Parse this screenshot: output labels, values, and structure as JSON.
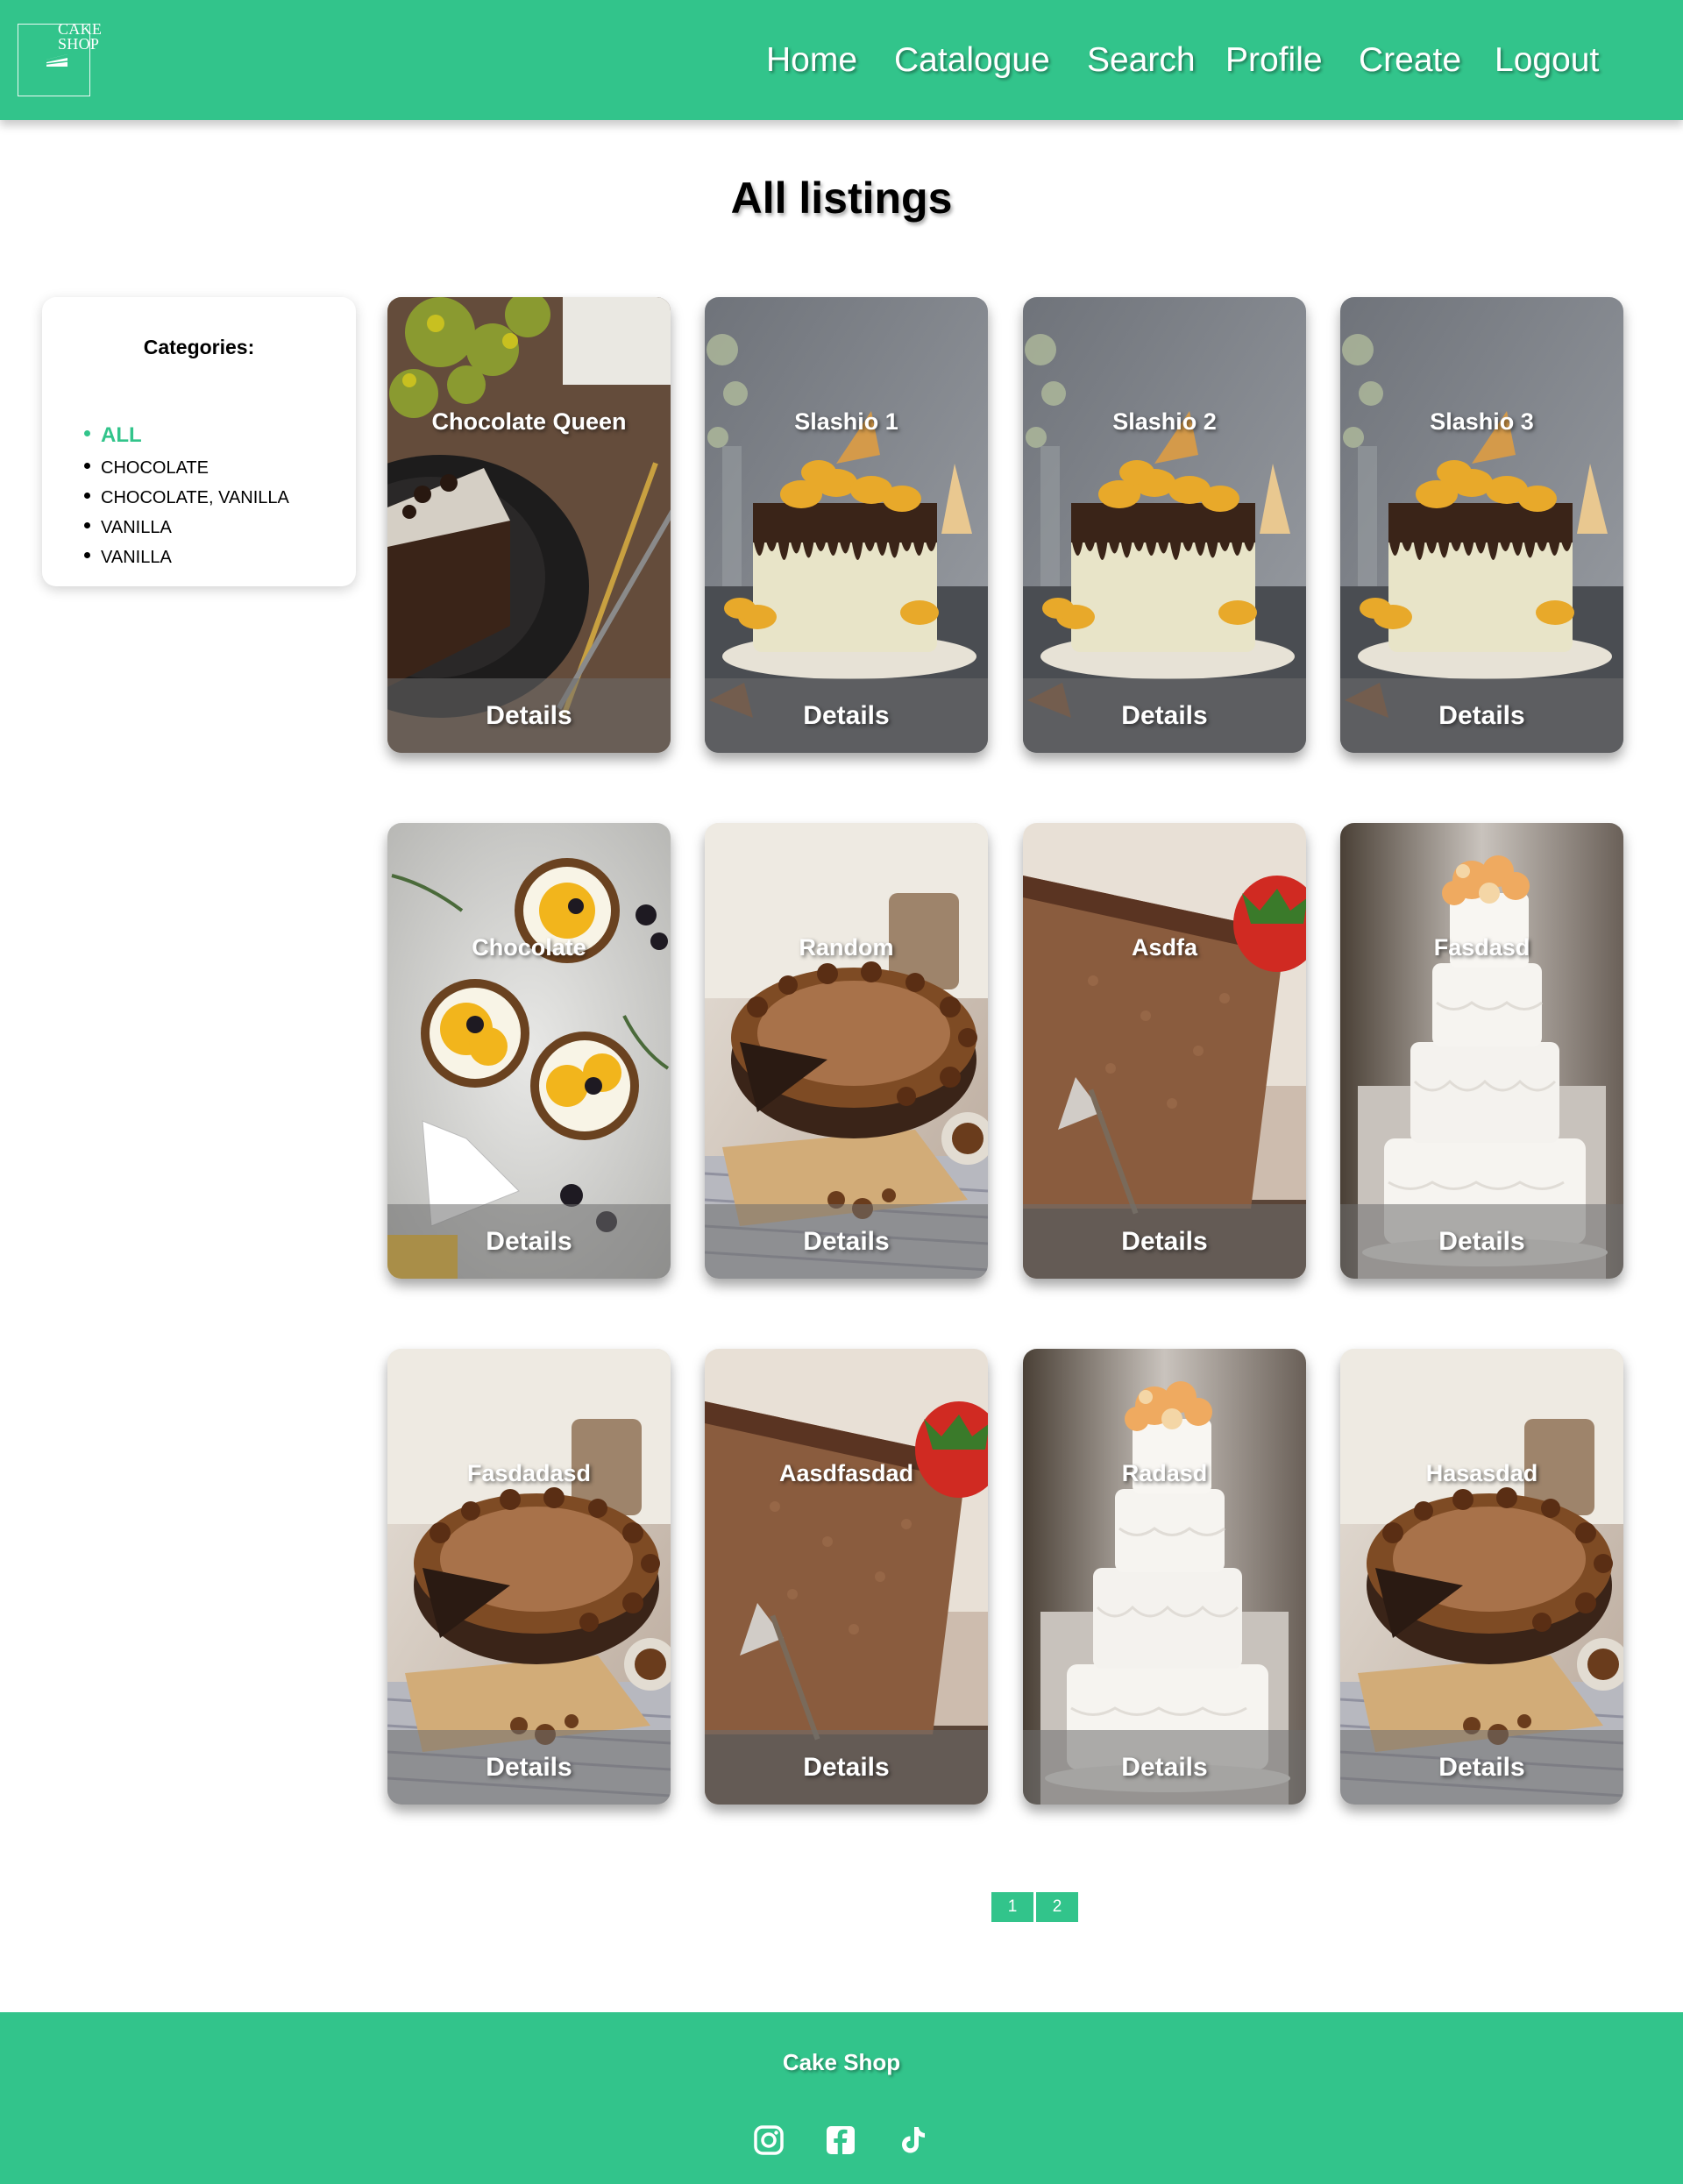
{
  "header": {
    "logo": {
      "line1": "CAKE",
      "line2": "SHOP"
    },
    "nav": [
      {
        "label": "Home",
        "icon": ""
      },
      {
        "label": "Catalogue"
      },
      {
        "label": "Search"
      },
      {
        "label": "Profile"
      },
      {
        "label": "Create"
      },
      {
        "label": "Logout"
      }
    ]
  },
  "page": {
    "title": "All listings"
  },
  "categories": {
    "title": "Categories:",
    "items": [
      {
        "label": "ALL",
        "active": true
      },
      {
        "label": "CHOCOLATE"
      },
      {
        "label": "CHOCOLATE, VANILLA"
      },
      {
        "label": "VANILLA"
      },
      {
        "label": "VANILLA"
      }
    ]
  },
  "listings": [
    {
      "title": "Chocolate Queen",
      "details_label": "Details",
      "image": "chocolate-slice-plate"
    },
    {
      "title": "Slashio 1",
      "details_label": "Details",
      "image": "drip-cake-macarons"
    },
    {
      "title": "Slashio 2",
      "details_label": "Details",
      "image": "drip-cake-macarons"
    },
    {
      "title": "Slashio 3",
      "details_label": "Details",
      "image": "drip-cake-macarons"
    },
    {
      "title": "Chocolate",
      "details_label": "Details",
      "image": "citrus-tarts"
    },
    {
      "title": "Random",
      "details_label": "Details",
      "image": "chocolate-tart-board"
    },
    {
      "title": "Asdfa",
      "details_label": "Details",
      "image": "chocolate-slice-strawberry"
    },
    {
      "title": "Fasdasd",
      "details_label": "Details",
      "image": "white-tiered-cake"
    },
    {
      "title": "Fasdadasd",
      "details_label": "Details",
      "image": "chocolate-tart-board"
    },
    {
      "title": "Aasdfasdad",
      "details_label": "Details",
      "image": "chocolate-slice-strawberry"
    },
    {
      "title": "Radasd",
      "details_label": "Details",
      "image": "white-tiered-cake"
    },
    {
      "title": "Hasasdad",
      "details_label": "Details",
      "image": "chocolate-tart-board"
    }
  ],
  "pagination": {
    "pages": [
      "1",
      "2"
    ],
    "current": "1"
  },
  "footer": {
    "title": "Cake Shop",
    "social": [
      "instagram-icon",
      "facebook-icon",
      "tiktok-icon"
    ]
  },
  "colors": {
    "accent": "#32c48b"
  }
}
